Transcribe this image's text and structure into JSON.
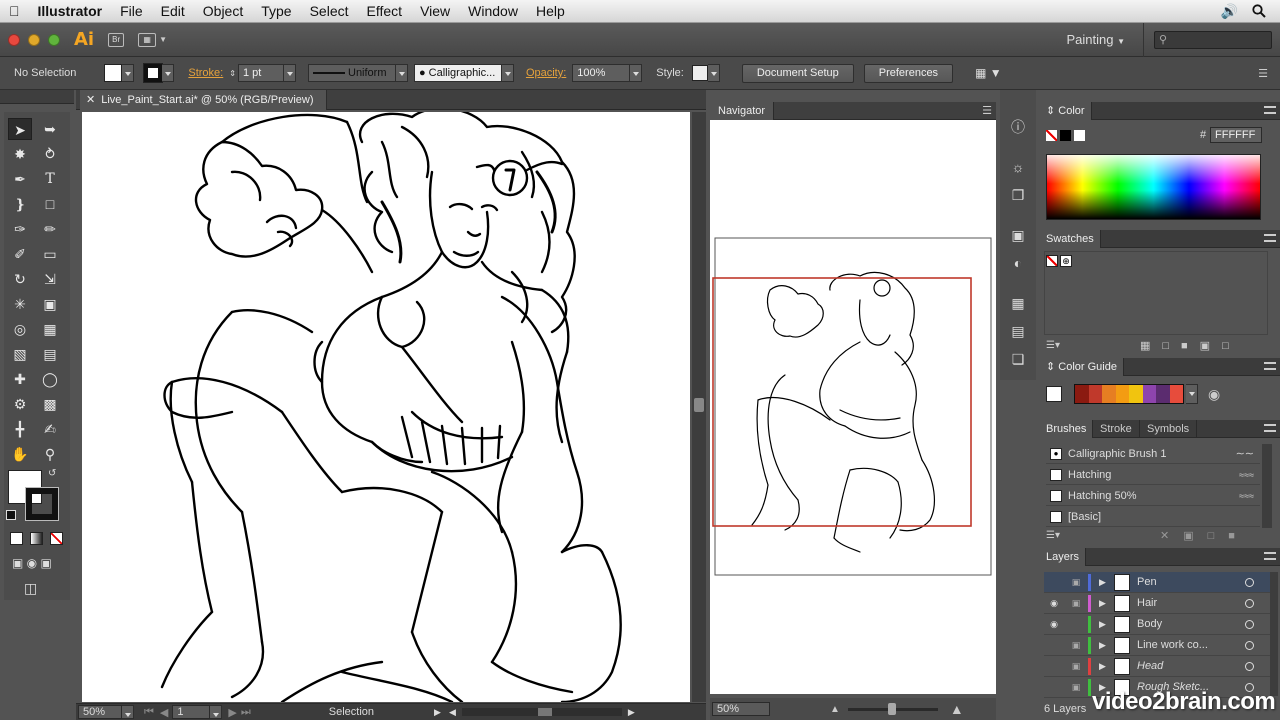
{
  "menubar": {
    "app": "Illustrator",
    "items": [
      "File",
      "Edit",
      "Object",
      "Type",
      "Select",
      "Effect",
      "View",
      "Window",
      "Help"
    ]
  },
  "appbar": {
    "logo": "Ai",
    "bridge": "Br",
    "workspace": "Painting"
  },
  "control": {
    "selection": "No Selection",
    "stroke_label": "Stroke:",
    "stroke_value": "1 pt",
    "profile": "Uniform",
    "brush": "Calligraphic...",
    "opacity_label": "Opacity:",
    "opacity_value": "100%",
    "style_label": "Style:",
    "document_setup": "Document Setup",
    "preferences": "Preferences"
  },
  "document": {
    "tab": "Live_Paint_Start.ai* @ 50% (RGB/Preview)",
    "zoom": "50%",
    "artboard": "1",
    "status": "Selection"
  },
  "navigator": {
    "title": "Navigator",
    "zoom": "50%"
  },
  "color_panel": {
    "title": "Color",
    "hex_label": "#",
    "hex": "FFFFFF"
  },
  "swatches": {
    "title": "Swatches"
  },
  "color_guide": {
    "title": "Color Guide",
    "colors": [
      "#8b1a10",
      "#c0392b",
      "#e67e22",
      "#f39c12",
      "#f1c40f",
      "#8e44ad",
      "#5b2c6f",
      "#e74c3c"
    ]
  },
  "brushes": {
    "tabs": [
      "Brushes",
      "Stroke",
      "Symbols"
    ],
    "items": [
      "Calligraphic Brush 1",
      "Hatching",
      "Hatching 50%",
      "[Basic]"
    ]
  },
  "layers": {
    "title": "Layers",
    "count": "6 Layers",
    "items": [
      {
        "name": "Pen",
        "color": "#4f6bd8"
      },
      {
        "name": "Hair",
        "color": "#d05cd0"
      },
      {
        "name": "Body",
        "color": "#3fbf3f"
      },
      {
        "name": "Line work co...",
        "color": "#3fbf3f"
      },
      {
        "name": "Head",
        "color": "#e04040"
      },
      {
        "name": "Rough Sketc...",
        "color": "#3fbf3f"
      }
    ]
  },
  "watermark": "video2brain.com"
}
